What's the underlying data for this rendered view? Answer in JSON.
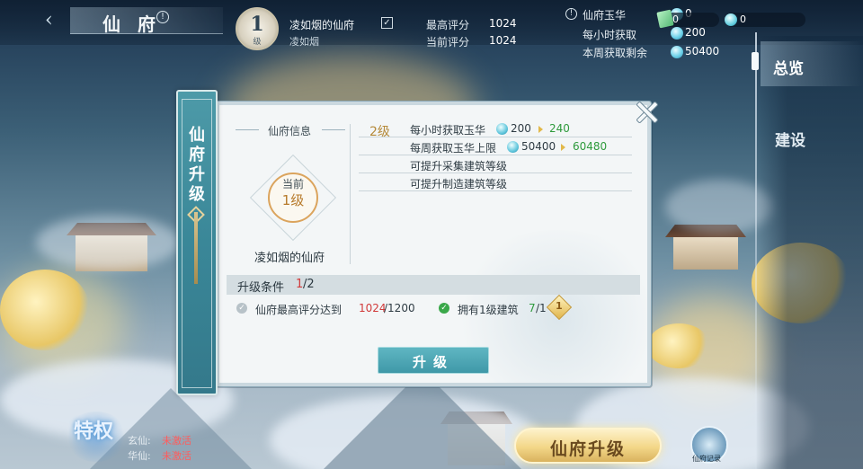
{
  "header": {
    "title": "仙 府",
    "info_glyph": "!",
    "back_glyph": "‹"
  },
  "profile": {
    "level": "1",
    "level_unit": "级",
    "owner_name": "凌如烟的仙府",
    "owner_check": "✓",
    "owner_sub": "凌如烟"
  },
  "scores": {
    "max_label": "最高评分",
    "max_value": "1024",
    "current_label": "当前评分",
    "current_value": "1024"
  },
  "resources": {
    "title": "仙府玉华",
    "info_glyph": "!",
    "hourly_label": "每小时获取",
    "hourly_value": "200",
    "weekly_label": "本周获取剩余",
    "weekly_value": "50400",
    "jade_top_value": "0"
  },
  "currencies": {
    "card_value": "0",
    "gem_value": "0"
  },
  "side_nav": {
    "overview": "总览",
    "build": "建设"
  },
  "dialog": {
    "tab_title": "仙府升级",
    "info_header": "仙府信息",
    "emblem_current": "当前",
    "emblem_level": "1级",
    "fu_name": "凌如烟的仙府",
    "next_level": "2级",
    "perks": [
      {
        "label": "每小时获取玉华",
        "old": "200",
        "new": "240"
      },
      {
        "label": "每周获取玉华上限",
        "old": "50400",
        "new": "60480"
      },
      {
        "label": "可提升采集建筑等级"
      },
      {
        "label": "可提升制造建筑等级"
      }
    ],
    "conditions_title": "升级条件",
    "conditions_done": "1",
    "conditions_total": "/2",
    "conditions": [
      {
        "text": "仙府最高评分达到",
        "current": "1024",
        "target": "/1200",
        "met": false
      },
      {
        "text": "拥有1级建筑",
        "current": "7",
        "target": "/1",
        "met": true
      }
    ],
    "level_gem": "1",
    "upgrade_button": "升级"
  },
  "bottom": {
    "privilege": "特权",
    "stat1_label": "玄仙:",
    "stat1_value": "未激活",
    "stat2_label": "华仙:",
    "stat2_value": "未激活",
    "upgrade_cta": "仙府升级",
    "memory_label": "仙府记录"
  }
}
